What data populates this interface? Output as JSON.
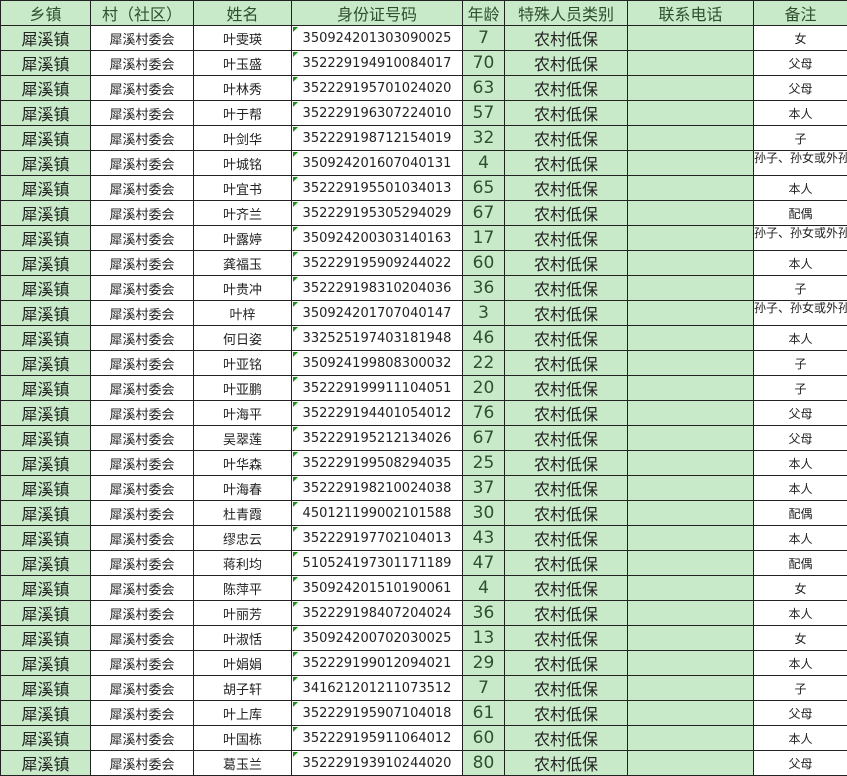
{
  "headers": [
    "乡镇",
    "村（社区）",
    "姓名",
    "身份证号码",
    "年龄",
    "特殊人员类别",
    "联系电话",
    "备注"
  ],
  "rows": [
    {
      "town": "犀溪镇",
      "village": "犀溪村委会",
      "name": "叶雯瑛",
      "id": "350924201303090025",
      "age": "7",
      "category": "农村低保",
      "phone": "",
      "note": "女"
    },
    {
      "town": "犀溪镇",
      "village": "犀溪村委会",
      "name": "叶玉盛",
      "id": "352229194910084017",
      "age": "70",
      "category": "农村低保",
      "phone": "",
      "note": "父母"
    },
    {
      "town": "犀溪镇",
      "village": "犀溪村委会",
      "name": "叶林秀",
      "id": "352229195701024020",
      "age": "63",
      "category": "农村低保",
      "phone": "",
      "note": "父母"
    },
    {
      "town": "犀溪镇",
      "village": "犀溪村委会",
      "name": "叶于帮",
      "id": "352229196307224010",
      "age": "57",
      "category": "农村低保",
      "phone": "",
      "note": "本人"
    },
    {
      "town": "犀溪镇",
      "village": "犀溪村委会",
      "name": "叶剑华",
      "id": "352229198712154019",
      "age": "32",
      "category": "农村低保",
      "phone": "",
      "note": "子"
    },
    {
      "town": "犀溪镇",
      "village": "犀溪村委会",
      "name": "叶城铭",
      "id": "350924201607040131",
      "age": "4",
      "category": "农村低保",
      "phone": "",
      "note": "孙子、孙女或外孙子、外孙女"
    },
    {
      "town": "犀溪镇",
      "village": "犀溪村委会",
      "name": "叶宜书",
      "id": "352229195501034013",
      "age": "65",
      "category": "农村低保",
      "phone": "",
      "note": "本人"
    },
    {
      "town": "犀溪镇",
      "village": "犀溪村委会",
      "name": "叶齐兰",
      "id": "352229195305294029",
      "age": "67",
      "category": "农村低保",
      "phone": "",
      "note": "配偶"
    },
    {
      "town": "犀溪镇",
      "village": "犀溪村委会",
      "name": "叶露婷",
      "id": "350924200303140163",
      "age": "17",
      "category": "农村低保",
      "phone": "",
      "note": "孙子、孙女或外孙子、外孙女"
    },
    {
      "town": "犀溪镇",
      "village": "犀溪村委会",
      "name": "龚福玉",
      "id": "352229195909244022",
      "age": "60",
      "category": "农村低保",
      "phone": "",
      "note": "本人"
    },
    {
      "town": "犀溪镇",
      "village": "犀溪村委会",
      "name": "叶贵冲",
      "id": "352229198310204036",
      "age": "36",
      "category": "农村低保",
      "phone": "",
      "note": "子"
    },
    {
      "town": "犀溪镇",
      "village": "犀溪村委会",
      "name": "叶梓",
      "id": "350924201707040147",
      "age": "3",
      "category": "农村低保",
      "phone": "",
      "note": "孙子、孙女或外孙子、外孙女"
    },
    {
      "town": "犀溪镇",
      "village": "犀溪村委会",
      "name": "何日姿",
      "id": "332525197403181948",
      "age": "46",
      "category": "农村低保",
      "phone": "",
      "note": "本人"
    },
    {
      "town": "犀溪镇",
      "village": "犀溪村委会",
      "name": "叶亚铭",
      "id": "350924199808300032",
      "age": "22",
      "category": "农村低保",
      "phone": "",
      "note": "子"
    },
    {
      "town": "犀溪镇",
      "village": "犀溪村委会",
      "name": "叶亚鹏",
      "id": "352229199911104051",
      "age": "20",
      "category": "农村低保",
      "phone": "",
      "note": "子"
    },
    {
      "town": "犀溪镇",
      "village": "犀溪村委会",
      "name": "叶海平",
      "id": "352229194401054012",
      "age": "76",
      "category": "农村低保",
      "phone": "",
      "note": "父母"
    },
    {
      "town": "犀溪镇",
      "village": "犀溪村委会",
      "name": "吴翠莲",
      "id": "352229195212134026",
      "age": "67",
      "category": "农村低保",
      "phone": "",
      "note": "父母"
    },
    {
      "town": "犀溪镇",
      "village": "犀溪村委会",
      "name": "叶华森",
      "id": "352229199508294035",
      "age": "25",
      "category": "农村低保",
      "phone": "",
      "note": "本人"
    },
    {
      "town": "犀溪镇",
      "village": "犀溪村委会",
      "name": "叶海春",
      "id": "352229198210024038",
      "age": "37",
      "category": "农村低保",
      "phone": "",
      "note": "本人"
    },
    {
      "town": "犀溪镇",
      "village": "犀溪村委会",
      "name": "杜青霞",
      "id": "450121199002101588",
      "age": "30",
      "category": "农村低保",
      "phone": "",
      "note": "配偶"
    },
    {
      "town": "犀溪镇",
      "village": "犀溪村委会",
      "name": "缪忠云",
      "id": "352229197702104013",
      "age": "43",
      "category": "农村低保",
      "phone": "",
      "note": "本人"
    },
    {
      "town": "犀溪镇",
      "village": "犀溪村委会",
      "name": "蒋利均",
      "id": "510524197301171189",
      "age": "47",
      "category": "农村低保",
      "phone": "",
      "note": "配偶"
    },
    {
      "town": "犀溪镇",
      "village": "犀溪村委会",
      "name": "陈萍平",
      "id": "350924201510190061",
      "age": "4",
      "category": "农村低保",
      "phone": "",
      "note": "女"
    },
    {
      "town": "犀溪镇",
      "village": "犀溪村委会",
      "name": "叶丽芳",
      "id": "352229198407204024",
      "age": "36",
      "category": "农村低保",
      "phone": "",
      "note": "本人"
    },
    {
      "town": "犀溪镇",
      "village": "犀溪村委会",
      "name": "叶淑恬",
      "id": "350924200702030025",
      "age": "13",
      "category": "农村低保",
      "phone": "",
      "note": "女"
    },
    {
      "town": "犀溪镇",
      "village": "犀溪村委会",
      "name": "叶娟娟",
      "id": "352229199012094021",
      "age": "29",
      "category": "农村低保",
      "phone": "",
      "note": "本人"
    },
    {
      "town": "犀溪镇",
      "village": "犀溪村委会",
      "name": "胡子轩",
      "id": "341621201211073512",
      "age": "7",
      "category": "农村低保",
      "phone": "",
      "note": "子"
    },
    {
      "town": "犀溪镇",
      "village": "犀溪村委会",
      "name": "叶上库",
      "id": "352229195907104018",
      "age": "61",
      "category": "农村低保",
      "phone": "",
      "note": "父母"
    },
    {
      "town": "犀溪镇",
      "village": "犀溪村委会",
      "name": "叶国栋",
      "id": "352229195911064012",
      "age": "60",
      "category": "农村低保",
      "phone": "",
      "note": "本人"
    },
    {
      "town": "犀溪镇",
      "village": "犀溪村委会",
      "name": "葛玉兰",
      "id": "352229193910244020",
      "age": "80",
      "category": "农村低保",
      "phone": "",
      "note": "父母"
    }
  ]
}
